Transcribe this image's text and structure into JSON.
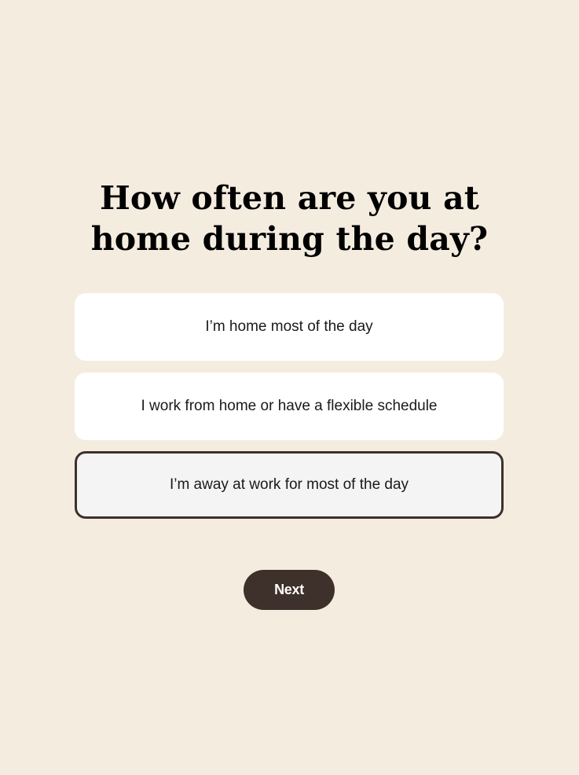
{
  "question": {
    "title_line_1": "How often are you at",
    "title_line_2": "home during the day?"
  },
  "options": [
    {
      "label": "I’m home most of the day",
      "selected": false
    },
    {
      "label": "I work from home or have a flexible schedule",
      "selected": false
    },
    {
      "label": "I’m away at work for most of the day",
      "selected": true
    }
  ],
  "actions": {
    "next_label": "Next"
  },
  "colors": {
    "background": "#f5ece0",
    "option_background": "#ffffff",
    "selected_background": "#f4f4f4",
    "accent_dark": "#3e302a",
    "title_text": "#000000"
  }
}
